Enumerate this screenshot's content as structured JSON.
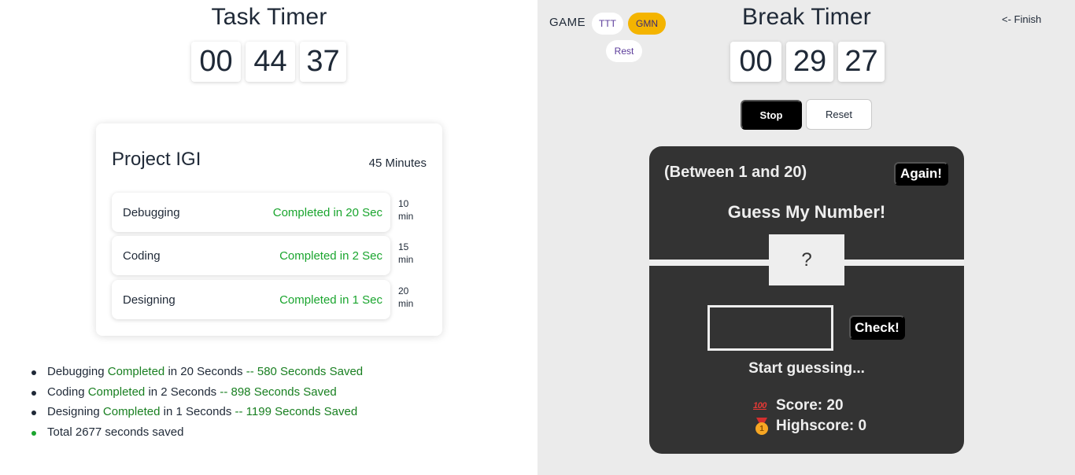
{
  "task_timer": {
    "title": "Task Timer",
    "hours": "00",
    "minutes": "44",
    "seconds": "37"
  },
  "project": {
    "name": "Project IGI",
    "duration": "45 Minutes",
    "tasks": [
      {
        "name": "Debugging",
        "status": "Completed in 20 Sec",
        "mins_value": "10",
        "mins_unit": "min"
      },
      {
        "name": "Coding",
        "status": "Completed in 2 Sec",
        "mins_value": "15",
        "mins_unit": "min"
      },
      {
        "name": "Designing",
        "status": "Completed in 1 Sec",
        "mins_value": "20",
        "mins_unit": "min"
      }
    ]
  },
  "summary": {
    "items": [
      {
        "task": "Debugging",
        "completed": "Completed",
        "mid": "in 20 Seconds",
        "saved": "-- 580 Seconds Saved"
      },
      {
        "task": "Coding",
        "completed": "Completed",
        "mid": "in 2 Seconds",
        "saved": "-- 898 Seconds Saved"
      },
      {
        "task": "Designing",
        "completed": "Completed",
        "mid": "in 1 Seconds",
        "saved": "-- 1199 Seconds Saved"
      }
    ],
    "total": "Total 2677 seconds saved"
  },
  "break_panel": {
    "game_label": "GAME",
    "ttt_label": "TTT",
    "gmn_label": "GMN",
    "rest_label": "Rest",
    "finish_label": "<- Finish"
  },
  "break_timer": {
    "title": "Break Timer",
    "hours": "00",
    "minutes": "29",
    "seconds": "27",
    "stop_label": "Stop",
    "reset_label": "Reset"
  },
  "game": {
    "range": "(Between 1 and 20)",
    "again_label": "Again!",
    "title": "Guess My Number!",
    "secret": "?",
    "guess_value": "",
    "check_label": "Check!",
    "message": "Start guessing...",
    "score_label": "Score: 20",
    "highscore_label": "Highscore: 0",
    "score_icon_glyph": "100"
  },
  "colors": {
    "accent_green": "#1aa52e",
    "gmn_active": "#f4b400",
    "game_bg": "#333333",
    "break_bg": "#ebebeb"
  }
}
